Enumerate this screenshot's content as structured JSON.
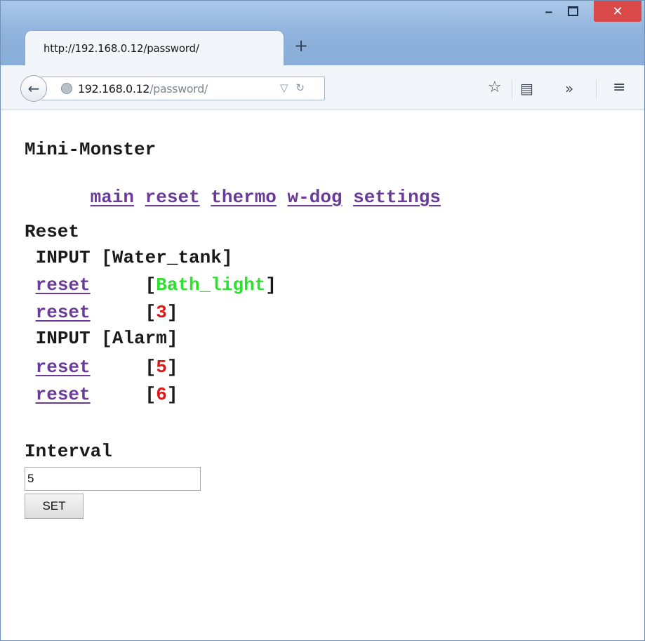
{
  "browser": {
    "tab_title": "http://192.168.0.12/password/",
    "new_tab_label": "+",
    "url_host": "192.168.0.12",
    "url_path": "/password/",
    "window_controls": {
      "minimize": "‒",
      "close": "✕"
    },
    "icons": [
      "back-arrow-icon",
      "globe-icon",
      "dropdown-icon",
      "reload-icon",
      "bookmark-star-icon",
      "reading-list-icon",
      "overflow-chevron-icon",
      "hamburger-menu-icon"
    ]
  },
  "page": {
    "title": "Mini-Monster",
    "nav": [
      "main",
      "reset",
      "thermo",
      "w-dog",
      "settings"
    ],
    "section_title": "Reset",
    "rows": [
      {
        "kind": "input",
        "label": "INPUT",
        "name": "Water_tank",
        "color": ""
      },
      {
        "kind": "reset",
        "label": "reset",
        "name": "Bath_light",
        "color": "#2ee02e"
      },
      {
        "kind": "reset",
        "label": "reset",
        "name": "3",
        "color": "#e01414"
      },
      {
        "kind": "input",
        "label": "INPUT",
        "name": "Alarm",
        "color": ""
      },
      {
        "kind": "reset",
        "label": "reset",
        "name": "5",
        "color": "#e01414"
      },
      {
        "kind": "reset",
        "label": "reset",
        "name": "6",
        "color": "#e01414"
      }
    ],
    "interval_label": "Interval",
    "interval_value": "5",
    "set_button": "SET"
  }
}
